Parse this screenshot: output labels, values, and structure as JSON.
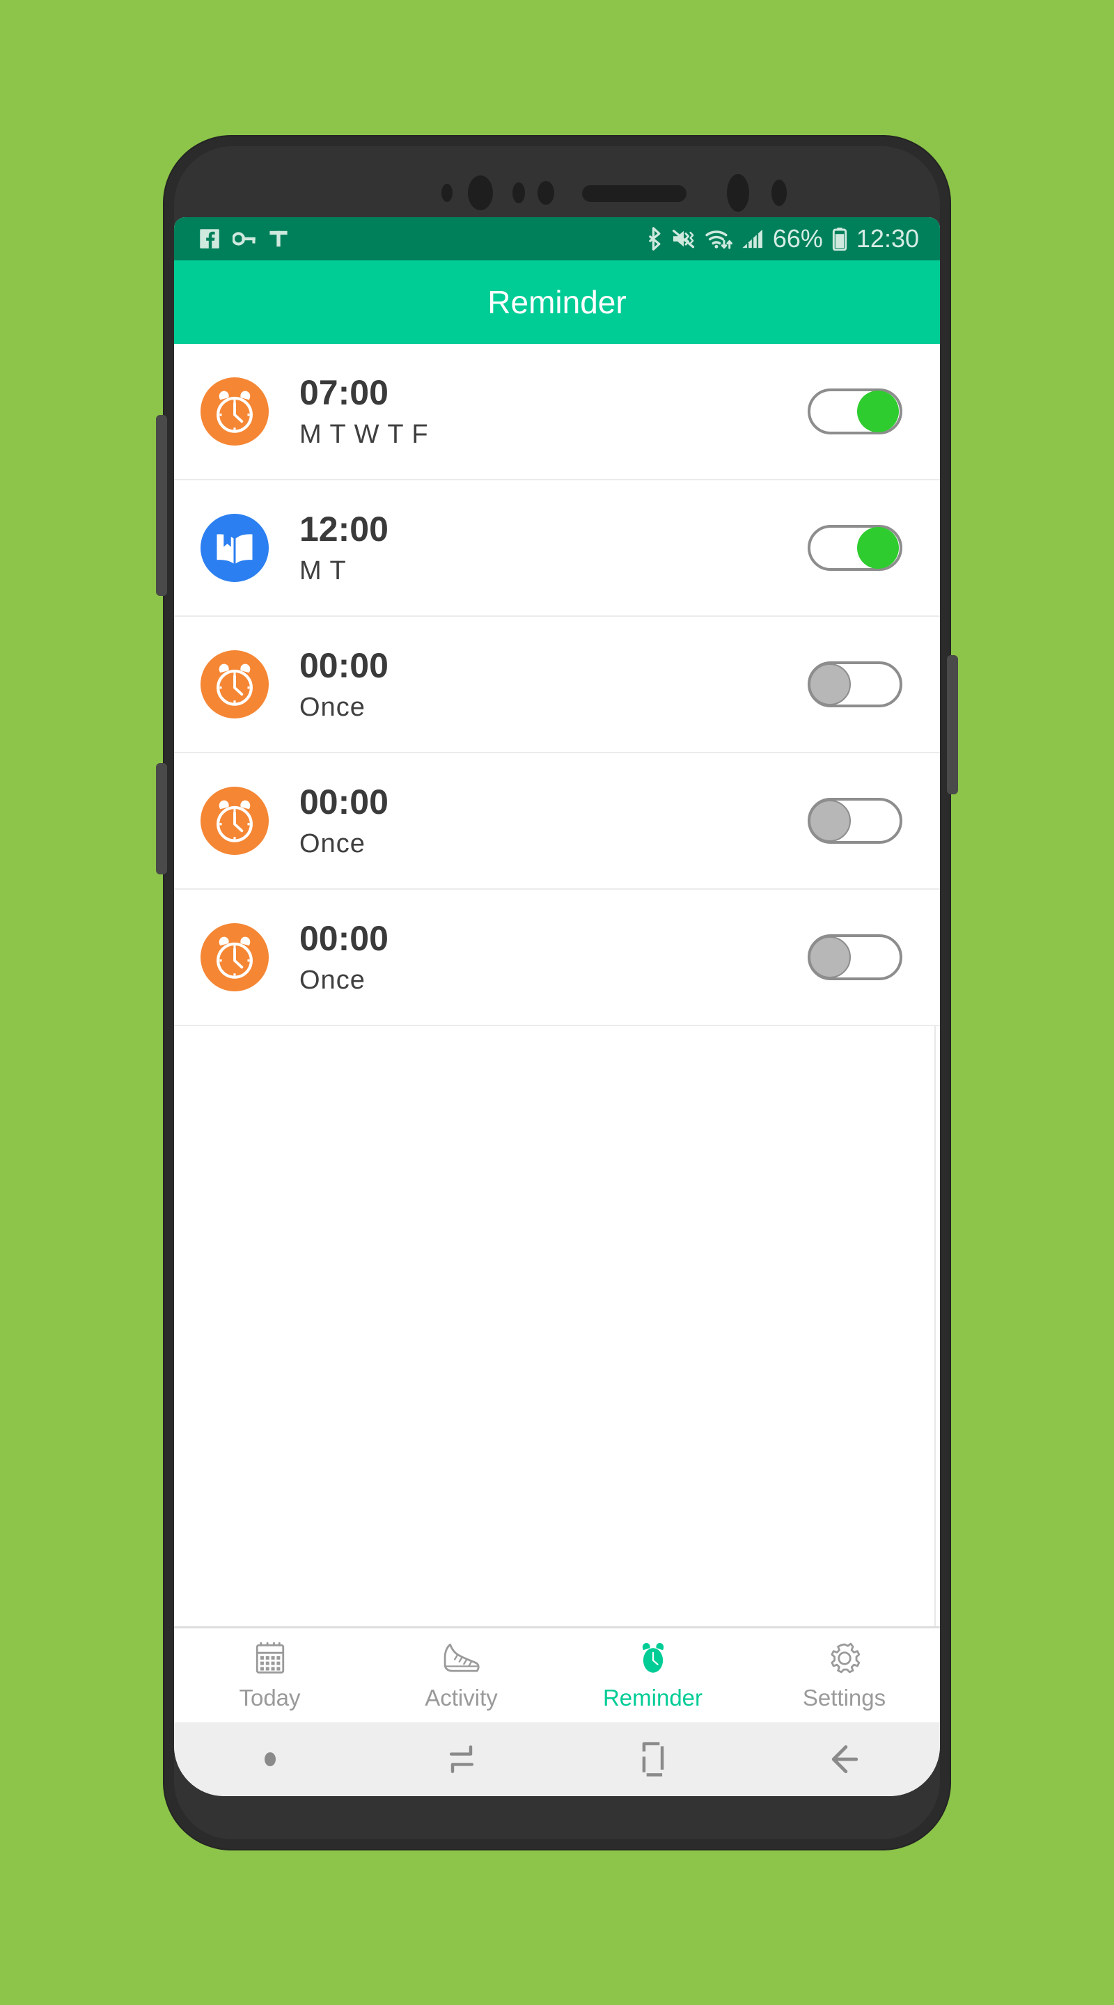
{
  "background_color": "#8CC549",
  "device": {
    "frame_color": "#2b2b2b",
    "name": "android-phone-mockup"
  },
  "status_bar": {
    "background": "#00805A",
    "left_icons": [
      {
        "name": "facebook-icon",
        "glyph": "f"
      },
      {
        "name": "vpn-key-icon",
        "glyph": "key"
      },
      {
        "name": "text-input-icon",
        "glyph": "T"
      }
    ],
    "right_icons": [
      {
        "name": "bluetooth-icon"
      },
      {
        "name": "mute-vibrate-icon"
      },
      {
        "name": "wifi-icon"
      },
      {
        "name": "signal-bars-icon"
      }
    ],
    "battery_percent": "66%",
    "battery_icon": "battery-icon",
    "clock": "12:30"
  },
  "app_bar": {
    "title": "Reminder",
    "background": "#00CC96",
    "title_color": "#ffffff"
  },
  "reminders": [
    {
      "icon": "alarm-clock-icon",
      "icon_type": "alarm",
      "icon_color": "#F58634",
      "time": "07:00",
      "days": "M T W T F",
      "enabled": true,
      "toggle_state": "on"
    },
    {
      "icon": "book-icon",
      "icon_type": "book",
      "icon_color": "#2B7FF0",
      "time": "12:00",
      "days": "M T",
      "enabled": true,
      "toggle_state": "on"
    },
    {
      "icon": "alarm-clock-icon",
      "icon_type": "alarm",
      "icon_color": "#F58634",
      "time": "00:00",
      "days": "Once",
      "enabled": false,
      "toggle_state": "off"
    },
    {
      "icon": "alarm-clock-icon",
      "icon_type": "alarm",
      "icon_color": "#F58634",
      "time": "00:00",
      "days": "Once",
      "enabled": false,
      "toggle_state": "off"
    },
    {
      "icon": "alarm-clock-icon",
      "icon_type": "alarm",
      "icon_color": "#F58634",
      "time": "00:00",
      "days": "Once",
      "enabled": false,
      "toggle_state": "off"
    }
  ],
  "tab_bar": {
    "active_color": "#00CC96",
    "inactive_color": "#9a9a9a",
    "tabs": [
      {
        "label": "Today",
        "icon": "calendar-icon",
        "active": false
      },
      {
        "label": "Activity",
        "icon": "shoe-icon",
        "active": false
      },
      {
        "label": "Reminder",
        "icon": "alarm-clock-icon",
        "active": true
      },
      {
        "label": "Settings",
        "icon": "gear-icon",
        "active": false
      }
    ]
  },
  "system_nav": {
    "background": "#eeeeee",
    "items": [
      {
        "name": "nav-dot-indicator"
      },
      {
        "name": "recents-icon"
      },
      {
        "name": "home-icon"
      },
      {
        "name": "back-icon"
      }
    ]
  }
}
